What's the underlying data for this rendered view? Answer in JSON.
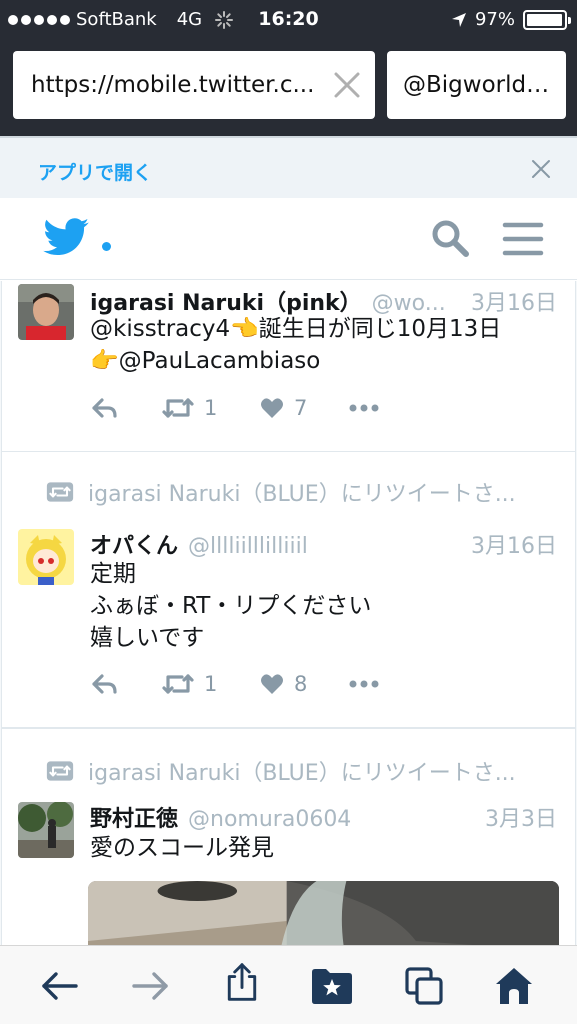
{
  "status_bar": {
    "carrier": "SoftBank",
    "network": "4G",
    "time": "16:20",
    "battery": "97%",
    "battery_level": 0.97
  },
  "browser": {
    "url": "https://mobile.twitter.c...",
    "second_box": "@Bigworld0..."
  },
  "app_banner": {
    "open_label": "アプリで開く"
  },
  "tweets": [
    {
      "retweet_label": "",
      "name": "igarasi Naruki（pink）",
      "handle": "@wo...",
      "time": "3月16日",
      "line1": "@kisstracy4👈誕生日が同じ10月13日",
      "line2": "👉@PauLacambiaso",
      "line3": "",
      "retweets": "1",
      "likes": "7"
    },
    {
      "retweet_label": "igarasi Naruki（BLUE）にリツイートさ...",
      "name": "オパくん",
      "handle": "@lllliilllilliiil",
      "time": "3月16日",
      "line1": "定期",
      "line2": "ふぁぼ・RT・リプください",
      "line3": "嬉しいです",
      "retweets": "1",
      "likes": "8"
    },
    {
      "retweet_label": "igarasi Naruki（BLUE）にリツイートさ...",
      "name": "野村正徳",
      "handle": "@nomura0604",
      "time": "3月3日",
      "line1": "愛のスコール発見"
    }
  ],
  "colors": {
    "accent": "#1da1f2",
    "chrome": "#282c34",
    "muted": "#aab8c2",
    "toolbar_icons": "#1f3a5a"
  },
  "icons": [
    "back-arrow-icon",
    "forward-arrow-icon",
    "share-icon",
    "bookmarks-icon",
    "tabs-icon",
    "home-icon"
  ]
}
